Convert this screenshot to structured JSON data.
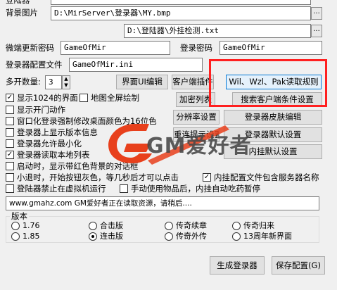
{
  "top_cut_label": "登陆器",
  "bg_image": {
    "label": "背景图片",
    "value": "D:\\MirServer\\登录器\\MY.bmp"
  },
  "plugin_path": {
    "value": "D:\\登陆器\\外挂检测.txt"
  },
  "update_password": {
    "label": "微端更新密码",
    "value": "GameOfMir"
  },
  "login_password": {
    "label": "登录密码",
    "value": "GameOfMir"
  },
  "config_file": {
    "label": "登录器配置文件",
    "value": "GameOfMir.ini"
  },
  "multi_open": {
    "label": "多开数量:",
    "value": "3"
  },
  "buttons": {
    "ui_edit": "界面UI编辑",
    "client_plugin": "客户端插件",
    "read_rules": "Wil、Wzl、Pak读取规则",
    "encrypt_list": "加密列表",
    "search_client": "搜索客户端条件设置",
    "resolution": "分辨率设置",
    "skin_edit": "登录器皮肤编辑",
    "reset_connect": "重连提示设置",
    "default_login": "登录器默认设置",
    "default_internal": "内挂默认设置",
    "generate": "生成登录器",
    "save_config": "保存配置(G)"
  },
  "checkboxes": [
    {
      "label": "显示1024的界面",
      "checked": true
    },
    {
      "label": "地图全屏绘制",
      "checked": false
    },
    {
      "label": "显示开门动作",
      "checked": false
    },
    {
      "label": "窗口化登录强制修改桌面颜色为16位色",
      "checked": false
    },
    {
      "label": "登录器上显示版本信息",
      "checked": false
    },
    {
      "label": "登录器允许最小化",
      "checked": false
    },
    {
      "label": "登录器读取本地列表",
      "checked": true
    },
    {
      "label": "启动时，显示带红色背景的对话框",
      "checked": false
    },
    {
      "label": "小退时，开始按钮灰色，等几秒后才可以点击",
      "checked": false
    },
    {
      "label": "内挂配置文件包含服务器名称",
      "checked": true
    },
    {
      "label": "登陆器禁止在虚拟机运行",
      "checked": false
    },
    {
      "label": "手动使用物品后，内挂自动吃药暂停",
      "checked": false
    }
  ],
  "status_text": "www.gmahz.com GM爱好者正在读取资源，请稍后....",
  "version": {
    "label": "版本",
    "options": [
      {
        "label": "1.76",
        "selected": false
      },
      {
        "label": "1.85",
        "selected": false
      },
      {
        "label": "合击版",
        "selected": false
      },
      {
        "label": "连击版",
        "selected": true
      },
      {
        "label": "传奇续章",
        "selected": false
      },
      {
        "label": "传奇外传",
        "selected": false
      },
      {
        "label": "传奇归来",
        "selected": false
      },
      {
        "label": "13周年新界面",
        "selected": false
      }
    ]
  },
  "watermark": {
    "text": "GM爱好者",
    "logo_color": "#e8401c",
    "text_color": "#4a4a4a"
  },
  "colors": {
    "highlight": "#ff2020",
    "focus": "#0078d7"
  }
}
